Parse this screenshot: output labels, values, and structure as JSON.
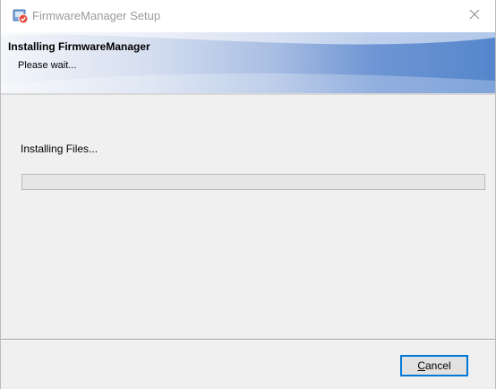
{
  "window": {
    "title": "FirmwareManager Setup",
    "app_icon": "installer-icon",
    "close_icon": "close-icon"
  },
  "banner": {
    "title": "Installing FirmwareManager",
    "subtitle": "Please wait..."
  },
  "status": {
    "text": "Installing Files...",
    "progress_percent": 0
  },
  "buttons": {
    "cancel_mnemonic": "C",
    "cancel_rest": "ancel"
  },
  "colors": {
    "banner_start": "#f4f6fa",
    "banner_end": "#5586cc",
    "focus_border": "#0078d7",
    "progress_fill": "#06b025"
  }
}
